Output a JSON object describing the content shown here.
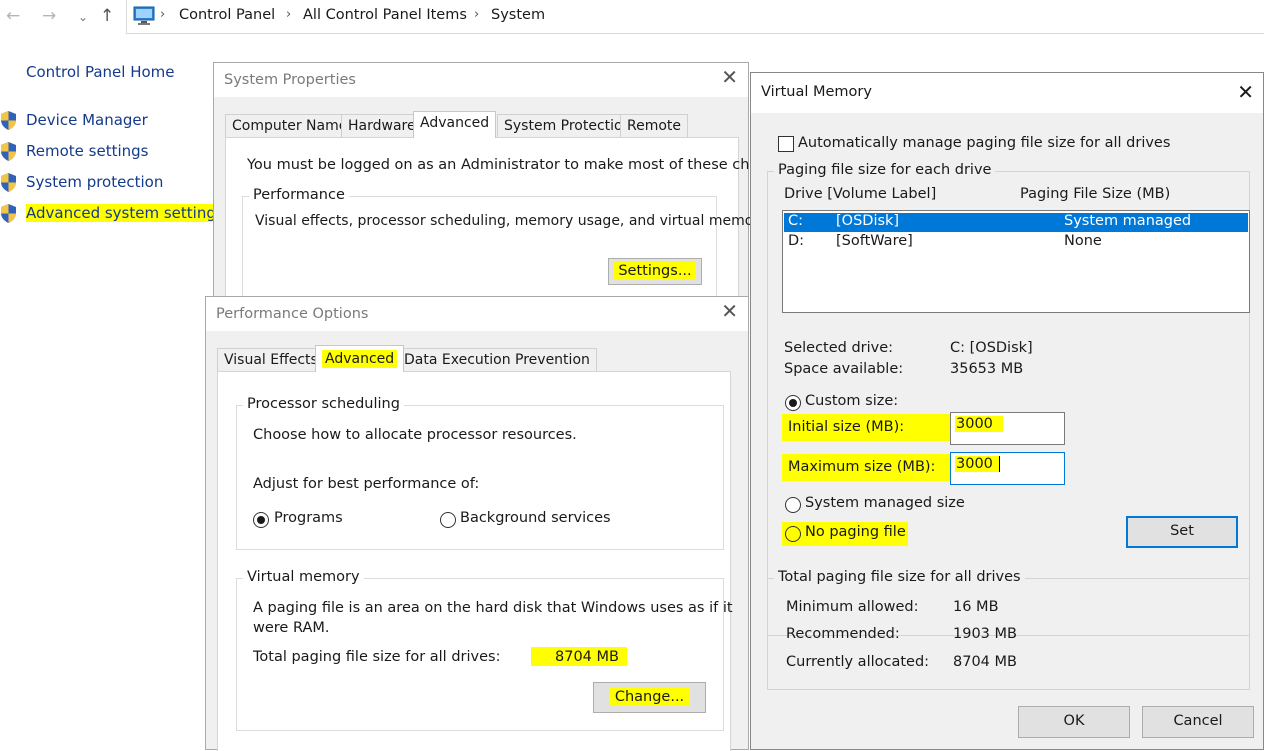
{
  "breadcrumb": {
    "items": [
      "Control Panel",
      "All Control Panel Items",
      "System"
    ]
  },
  "left_pane": {
    "home": "Control Panel Home",
    "links": [
      "Device Manager",
      "Remote settings",
      "System protection",
      "Advanced system settings"
    ]
  },
  "system_properties": {
    "title": "System Properties",
    "tabs": [
      "Computer Name",
      "Hardware",
      "Advanced",
      "System Protection",
      "Remote"
    ],
    "admin_note": "You must be logged on as an Administrator to make most of these changes.",
    "performance": {
      "label": "Performance",
      "desc": "Visual effects, processor scheduling, memory usage, and virtual memory",
      "settings_button": "Settings..."
    }
  },
  "performance_options": {
    "title": "Performance Options",
    "tabs": [
      "Visual Effects",
      "Advanced",
      "Data Execution Prevention"
    ],
    "processor": {
      "label": "Processor scheduling",
      "desc": "Choose how to allocate processor resources.",
      "adjust": "Adjust for best performance of:",
      "options": [
        "Programs",
        "Background services"
      ]
    },
    "virtual_memory": {
      "label": "Virtual memory",
      "desc_line1": "A paging file is an area on the hard disk that Windows uses as if it",
      "desc_line2": "were RAM.",
      "total_label": "Total paging file size for all drives:",
      "total_value": "8704 MB",
      "change_button": "Change..."
    }
  },
  "virtual_memory": {
    "title": "Virtual Memory",
    "auto_manage": "Automatically manage paging file size for all drives",
    "auto_manage_checked": false,
    "each_drive_label": "Paging file size for each drive",
    "col_drive": "Drive  [Volume Label]",
    "col_size": "Paging File Size (MB)",
    "drives": [
      {
        "drive": "C:",
        "label": "[OSDisk]",
        "size": "System managed"
      },
      {
        "drive": "D:",
        "label": "[SoftWare]",
        "size": "None"
      }
    ],
    "selected_drive_label": "Selected drive:",
    "selected_drive_value": "C:  [OSDisk]",
    "space_label": "Space available:",
    "space_value": "35653 MB",
    "custom_size": "Custom size:",
    "initial_label": "Initial size (MB):",
    "initial_value": "3000",
    "maximum_label": "Maximum size (MB):",
    "maximum_value": "3000",
    "system_managed": "System managed size",
    "no_paging": "No paging file",
    "set_button": "Set",
    "totals_label": "Total paging file size for all drives",
    "min_label": "Minimum allowed:",
    "min_value": "16 MB",
    "rec_label": "Recommended:",
    "rec_value": "1903 MB",
    "cur_label": "Currently allocated:",
    "cur_value": "8704 MB",
    "ok_button": "OK",
    "cancel_button": "Cancel"
  },
  "colors": {
    "highlight": "#ffff00",
    "selection": "#0078d7",
    "link": "#153a8c",
    "dialog_bg": "#f0f0f0"
  },
  "icons": {
    "back": "arrow-left-icon",
    "forward": "arrow-right-icon",
    "recent": "chevron-down-icon",
    "up": "arrow-up-icon",
    "computer": "computer-icon",
    "shield": "uac-shield-icon",
    "close": "close-icon"
  }
}
